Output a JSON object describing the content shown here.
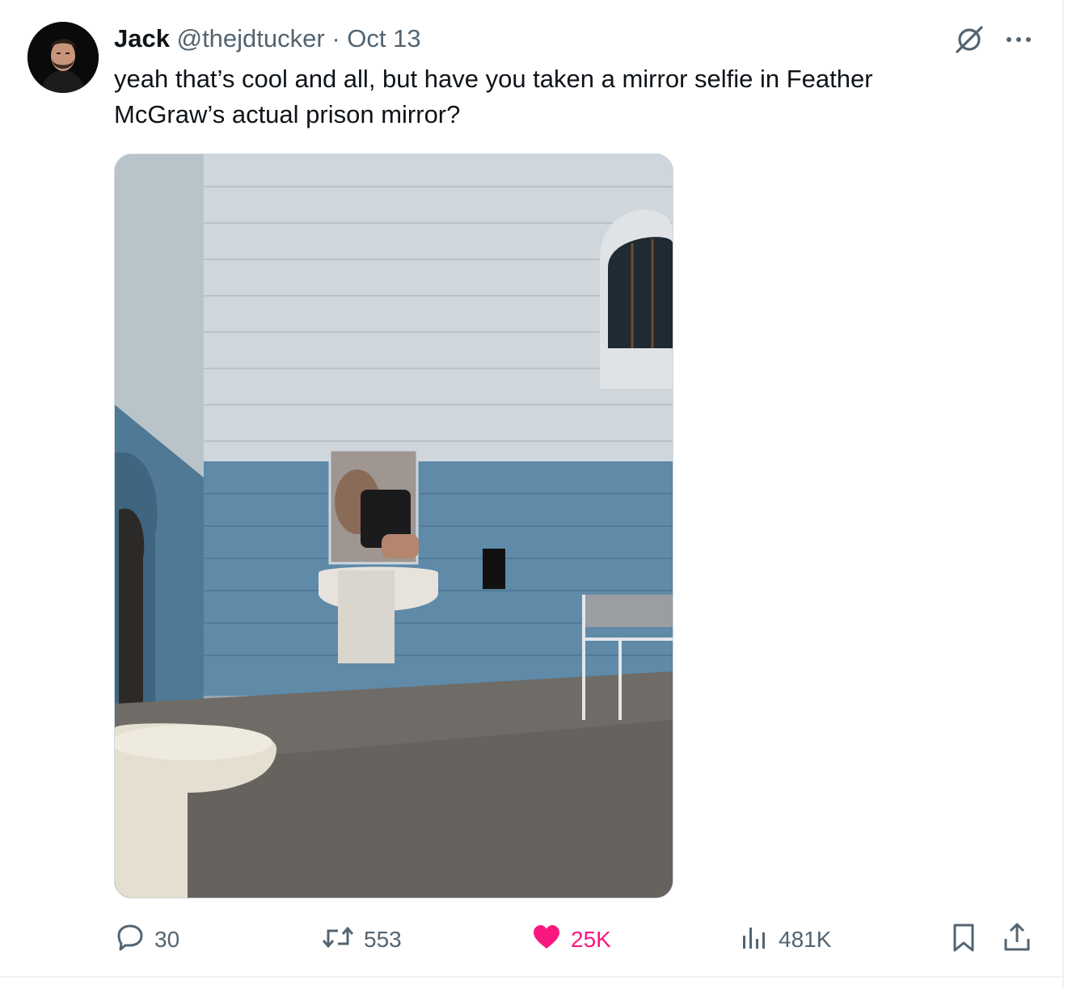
{
  "tweet": {
    "author_name": "Jack",
    "handle": "@thejdtucker",
    "separator": "·",
    "date": "Oct 13",
    "text": "yeah that’s cool and all, but have you taken a mirror selfie in Feather McGraw’s actual prison mirror?",
    "header_icons": [
      "grok-icon",
      "more-icon"
    ],
    "media": {
      "kind": "photo",
      "subject": "prison cell with mirror selfie",
      "colors": {
        "wall_upper": "#cfd6dc",
        "wall_lower": "#5f8aa8",
        "floor": "#6f6b66"
      }
    }
  },
  "actions": {
    "reply_count": "30",
    "retweet_count": "553",
    "like_count": "25K",
    "views_count": "481K",
    "icons": [
      "reply-icon",
      "retweet-icon",
      "heart-icon",
      "views-icon",
      "bookmark-icon",
      "share-icon"
    ]
  },
  "colors": {
    "text_primary": "#0f1419",
    "text_secondary": "#536471",
    "like_active": "#f91880",
    "border": "#cfd9de"
  }
}
